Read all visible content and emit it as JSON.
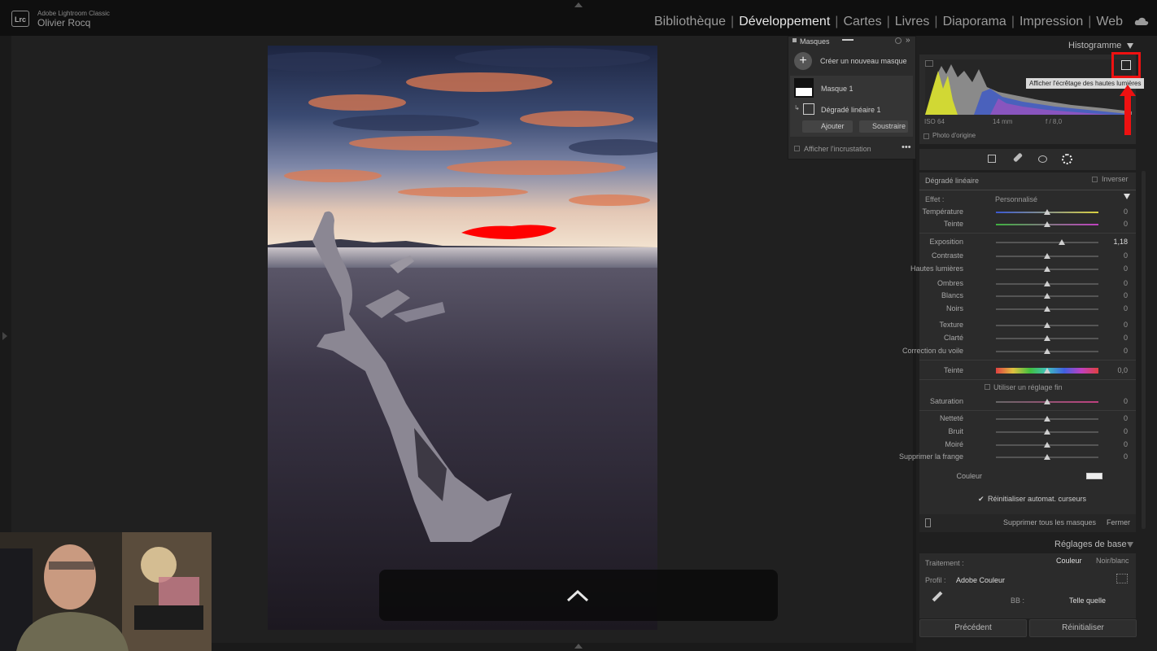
{
  "app": {
    "logo": "Lrc",
    "title": "Adobe Lightroom Classic",
    "user": "Olivier Rocq"
  },
  "modules": [
    {
      "label": "Bibliothèque",
      "active": false
    },
    {
      "label": "Développement",
      "active": true
    },
    {
      "label": "Cartes",
      "active": false
    },
    {
      "label": "Livres",
      "active": false
    },
    {
      "label": "Diaporama",
      "active": false
    },
    {
      "label": "Impression",
      "active": false
    },
    {
      "label": "Web",
      "active": false
    }
  ],
  "masks_panel": {
    "title": "Masques",
    "create_label": "Créer un nouveau masque",
    "mask_name": "Masque 1",
    "component_name": "Dégradé linéaire 1",
    "add_label": "Ajouter",
    "subtract_label": "Soustraire",
    "overlay_label": "Afficher l'incrustation"
  },
  "histogram": {
    "title": "Histogramme",
    "tooltip": "Afficher l'écrêtage des hautes lumières",
    "iso": "ISO 64",
    "focal": "14 mm",
    "aperture": "f / 8,0",
    "original_label": "Photo d'origine"
  },
  "mask_settings": {
    "section_title": "Dégradé linéaire",
    "invert_label": "Inverser",
    "effect_label": "Effet :",
    "effect_value": "Personnalisé",
    "fine_label": "Utiliser un réglage fin",
    "color_label": "Couleur",
    "auto_reset_label": "Réinitialiser automat. curseurs",
    "delete_all_label": "Supprimer tous les masques",
    "close_label": "Fermer",
    "sliders": [
      {
        "label": "Température",
        "value": "0",
        "pos": 0.5
      },
      {
        "label": "Teinte",
        "value": "0",
        "pos": 0.5
      },
      {
        "label": "Exposition",
        "value": "1,18",
        "pos": 0.64
      },
      {
        "label": "Contraste",
        "value": "0",
        "pos": 0.5
      },
      {
        "label": "Hautes lumières",
        "value": "0",
        "pos": 0.5
      },
      {
        "label": "Ombres",
        "value": "0",
        "pos": 0.5
      },
      {
        "label": "Blancs",
        "value": "0",
        "pos": 0.5
      },
      {
        "label": "Noirs",
        "value": "0",
        "pos": 0.5
      },
      {
        "label": "Texture",
        "value": "0",
        "pos": 0.5
      },
      {
        "label": "Clarté",
        "value": "0",
        "pos": 0.5
      },
      {
        "label": "Correction du voile",
        "value": "0",
        "pos": 0.5
      },
      {
        "label": "Teinte",
        "value": "0,0",
        "pos": 0.5
      },
      {
        "label": "Saturation",
        "value": "0",
        "pos": 0.5
      },
      {
        "label": "Netteté",
        "value": "0",
        "pos": 0.5
      },
      {
        "label": "Bruit",
        "value": "0",
        "pos": 0.5
      },
      {
        "label": "Moiré",
        "value": "0",
        "pos": 0.5
      },
      {
        "label": "Supprimer la frange",
        "value": "0",
        "pos": 0.5
      }
    ]
  },
  "basic": {
    "title": "Réglages de base",
    "treatment_label": "Traitement :",
    "color_option": "Couleur",
    "bw_option": "Noir/blanc",
    "profile_label": "Profil :",
    "profile_value": "Adobe Couleur",
    "wb_label": "BB :",
    "wb_value": "Telle quelle"
  },
  "footer": {
    "previous": "Précédent",
    "reset": "Réinitialiser"
  }
}
